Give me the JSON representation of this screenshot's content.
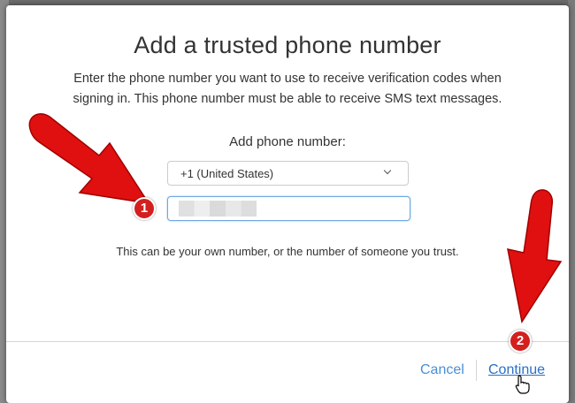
{
  "dialog": {
    "title": "Add a trusted phone number",
    "description": "Enter the phone number you want to use to receive verification codes when signing in. This phone number must be able to receive SMS text messages.",
    "phone_label": "Add phone number:",
    "country_select": {
      "value": "+1 (United States)"
    },
    "phone_input": {
      "value": ""
    },
    "hint": "This can be your own number, or the number of someone you trust.",
    "buttons": {
      "cancel": "Cancel",
      "continue": "Continue"
    }
  },
  "annotations": {
    "step1": "1",
    "step2": "2"
  },
  "colors": {
    "link": "#4a8fd8",
    "continue_link": "#2a6fc7",
    "annotation_red": "#e01010",
    "input_focus": "#6fa8dc"
  },
  "icons": [
    "chevron-down-icon",
    "hand-cursor-icon",
    "red-arrow-icon"
  ]
}
